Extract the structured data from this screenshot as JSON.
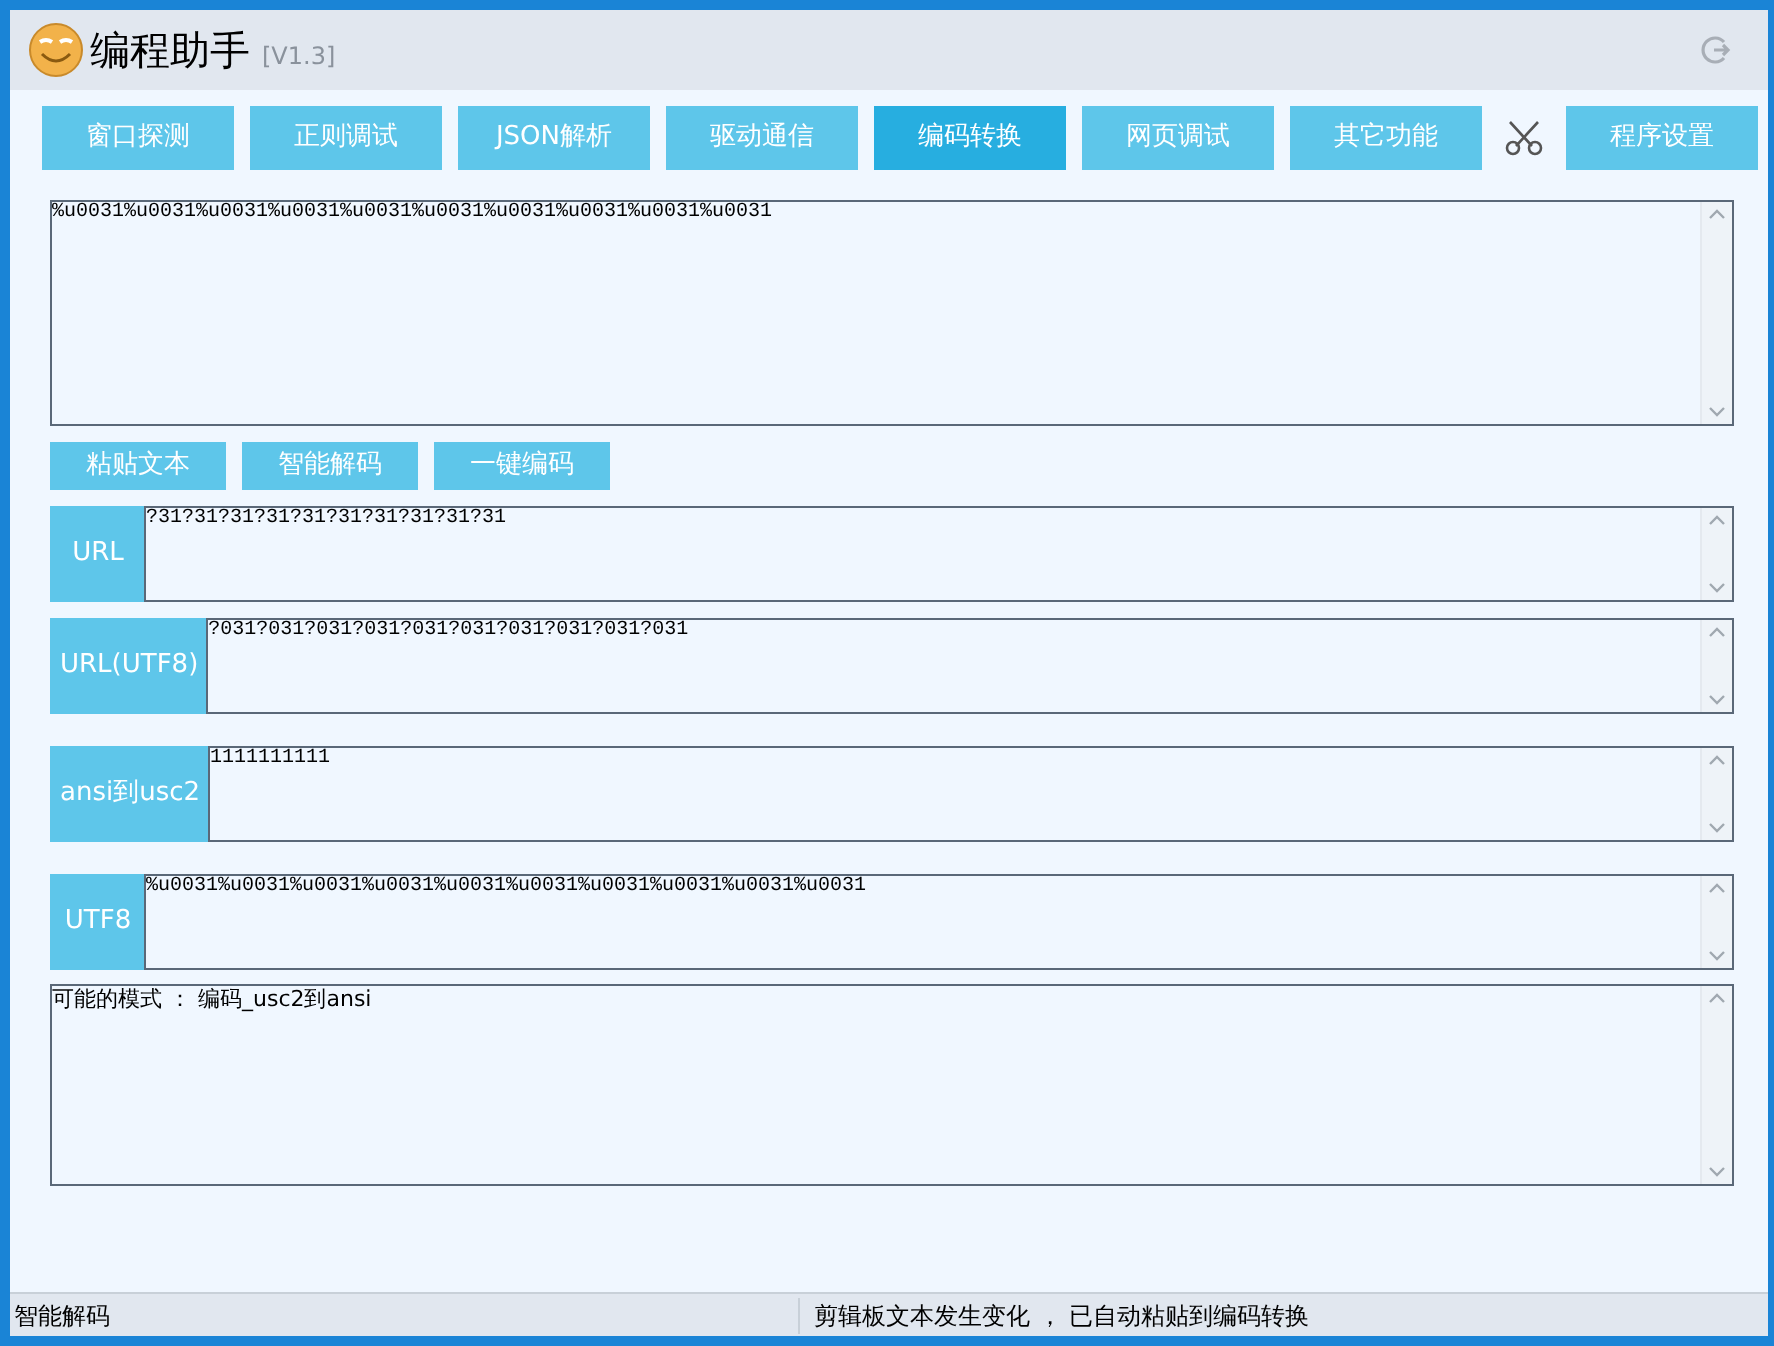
{
  "window": {
    "title": "编程助手",
    "version": "[V1.3]"
  },
  "tabs": [
    {
      "kind": "tab",
      "label": "窗口探测",
      "selected": false
    },
    {
      "kind": "tab",
      "label": "正则调试",
      "selected": false
    },
    {
      "kind": "tab",
      "label": "JSON解析",
      "selected": false
    },
    {
      "kind": "tab",
      "label": "驱动通信",
      "selected": false
    },
    {
      "kind": "tab",
      "label": "编码转换",
      "selected": true
    },
    {
      "kind": "tab",
      "label": "网页调试",
      "selected": false
    },
    {
      "kind": "tab",
      "label": "其它功能",
      "selected": false
    },
    {
      "kind": "scissors"
    },
    {
      "kind": "tab",
      "label": "程序设置",
      "selected": false
    }
  ],
  "input": {
    "value": "%u0031%u0031%u0031%u0031%u0031%u0031%u0031%u0031%u0031%u0031"
  },
  "buttons": [
    "粘贴文本",
    "智能解码",
    "一键编码"
  ],
  "fields": [
    {
      "label": "URL",
      "value": "?31?31?31?31?31?31?31?31?31?31"
    },
    {
      "label": "URL(UTF8)",
      "value": "?031?031?031?031?031?031?031?031?031?031"
    },
    {
      "label": "ansi到usc2",
      "value": "1111111111"
    },
    {
      "label": "UTF8",
      "value": "%u0031%u0031%u0031%u0031%u0031%u0031%u0031%u0031%u0031%u0031"
    }
  ],
  "result": {
    "value": "可能的模式 ： 编码_usc2到ansi"
  },
  "status_bar": [
    "智能解码",
    "剪辑板文本发生变化 ， 已自动粘贴到编码转换"
  ]
}
